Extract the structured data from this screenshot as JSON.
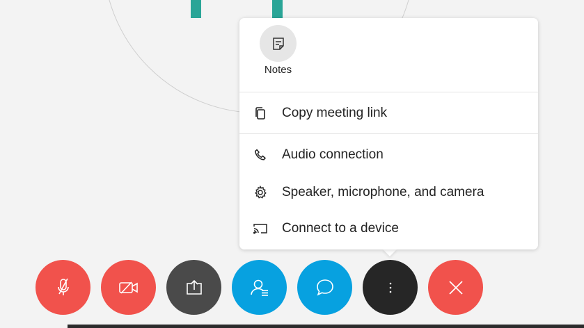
{
  "menu": {
    "notes": {
      "label": "Notes",
      "icon": "notes-icon"
    },
    "items": [
      {
        "label": "Copy meeting link",
        "icon": "copy-icon"
      },
      {
        "label": "Audio connection",
        "icon": "phone-icon"
      },
      {
        "label": "Speaker, microphone, and camera",
        "icon": "gear-icon"
      },
      {
        "label": "Connect to a device",
        "icon": "cast-icon"
      }
    ]
  },
  "controls": [
    {
      "name": "mute",
      "icon": "microphone-off-icon",
      "color": "#f1524c"
    },
    {
      "name": "video",
      "icon": "video-off-icon",
      "color": "#f1524c"
    },
    {
      "name": "share",
      "icon": "share-screen-icon",
      "color": "#4a4a4a"
    },
    {
      "name": "participants",
      "icon": "participants-icon",
      "color": "#07a1e0"
    },
    {
      "name": "chat",
      "icon": "chat-icon",
      "color": "#07a1e0"
    },
    {
      "name": "more",
      "icon": "more-options-icon",
      "color": "#262626"
    },
    {
      "name": "leave",
      "icon": "close-icon",
      "color": "#f1524c"
    }
  ],
  "colors": {
    "accent_teal": "#2aa597",
    "menu_bg": "#ffffff",
    "page_bg": "#f3f3f3"
  }
}
